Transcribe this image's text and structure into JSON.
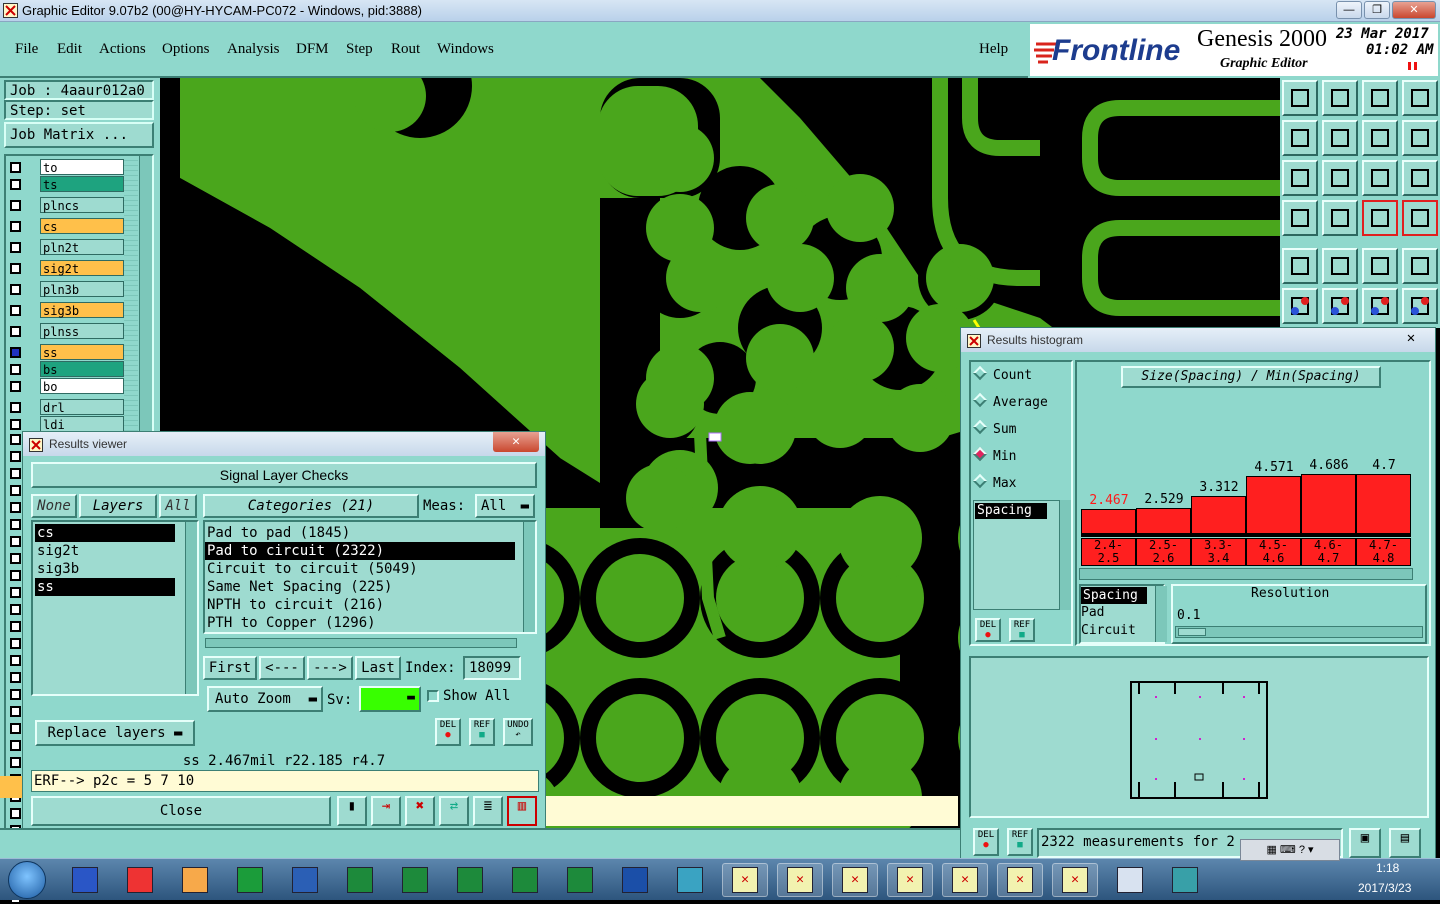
{
  "window": {
    "title": "Graphic Editor 9.07b2 (00@HY-HYCAM-PC072 - Windows, pid:3888)"
  },
  "menu": {
    "items": [
      "File",
      "Edit",
      "Actions",
      "Options",
      "Analysis",
      "DFM",
      "Step",
      "Rout",
      "Windows"
    ],
    "help": "Help"
  },
  "brand": {
    "logo": "Frontline",
    "product": "Genesis 2000",
    "subtitle": "Graphic Editor",
    "date": "23 Mar 2017",
    "time": "01:02 AM"
  },
  "job": {
    "job_label": "Job : 4aaur012a0",
    "step_label": "Step: set",
    "matrix_button": "Job Matrix ..."
  },
  "layers": [
    {
      "name": "to",
      "color": "#ffffff"
    },
    {
      "name": "ts",
      "color": "#1ea37f"
    },
    {
      "name": "plncs",
      "color": "#9edbd0"
    },
    {
      "name": "cs",
      "color": "#ffc04a"
    },
    {
      "name": "pln2t",
      "color": "#9edbd0"
    },
    {
      "name": "sig2t",
      "color": "#ffc04a"
    },
    {
      "name": "pln3b",
      "color": "#9edbd0"
    },
    {
      "name": "sig3b",
      "color": "#ffc04a"
    },
    {
      "name": "plnss",
      "color": "#9edbd0"
    },
    {
      "name": "ss",
      "color": "#ffc04a"
    },
    {
      "name": "bs",
      "color": "#1ea37f"
    },
    {
      "name": "bo",
      "color": "#ffffff"
    },
    {
      "name": "drl",
      "color": "#9edbd0"
    },
    {
      "name": "ldi",
      "color": "#9edbd0"
    }
  ],
  "histogram": {
    "window_title": "Results histogram",
    "heading": "Size(Spacing) / Min(Spacing)",
    "modes": [
      "Count",
      "Average",
      "Sum",
      "Min",
      "Max"
    ],
    "selected_mode": "Min",
    "list_item": "Spacing",
    "bins": [
      {
        "range_top": "2.4-",
        "range_bot": "2.5",
        "value": "2.467",
        "highlight": true
      },
      {
        "range_top": "2.5-",
        "range_bot": "2.6",
        "value": "2.529",
        "highlight": false
      },
      {
        "range_top": "3.3-",
        "range_bot": "3.4",
        "value": "3.312",
        "highlight": false
      },
      {
        "range_top": "4.5-",
        "range_bot": "4.6",
        "value": "4.571",
        "highlight": false
      },
      {
        "range_top": "4.6-",
        "range_bot": "4.7",
        "value": "4.686",
        "highlight": false
      },
      {
        "range_top": "4.7-",
        "range_bot": "4.8",
        "value": "4.7",
        "highlight": false
      }
    ],
    "bin_values": [
      2.467,
      2.529,
      3.312,
      4.571,
      4.686,
      4.7
    ],
    "type_list": [
      "Spacing",
      "Pad",
      "Circuit"
    ],
    "resolution_label": "Resolution",
    "resolution_value": "0.1",
    "status": "2322 measurements for 2",
    "del_label": "DEL",
    "ref_label": "REF"
  },
  "results_viewer": {
    "window_title": "Results viewer",
    "heading": "Signal Layer Checks",
    "none_btn": "None",
    "layers_btn": "Layers",
    "all_btn": "All",
    "layers": [
      "cs",
      "sig2t",
      "sig3b",
      "ss"
    ],
    "selected_layers": [
      "cs",
      "ss"
    ],
    "categories_label": "Categories (21)",
    "meas_label": "Meas:",
    "meas_value": "All",
    "categories": [
      "Pad to pad (1845)",
      "Pad to circuit (2322)",
      "Circuit to circuit (5049)",
      "Same Net Spacing (225)",
      "NPTH to circuit (216)",
      "PTH to Copper (1296)"
    ],
    "selected_category": "Pad to circuit (2322)",
    "nav": {
      "first": "First",
      "prev": "<---",
      "next": "--->",
      "last": "Last",
      "index_label": "Index:",
      "index_value": "18099"
    },
    "auto_zoom": "Auto Zoom",
    "sv_label": "Sv:",
    "show_all": "Show All",
    "replace_layers": "Replace layers",
    "info": "ss 2.467mil  r22.185  r4.7",
    "erf": "ERF--> p2c = 5 7 10",
    "close": "Close",
    "del": "DEL",
    "ref": "REF",
    "undo": "UNDO"
  },
  "taskbar": {
    "time": "1:18",
    "date": "2017/3/23"
  }
}
